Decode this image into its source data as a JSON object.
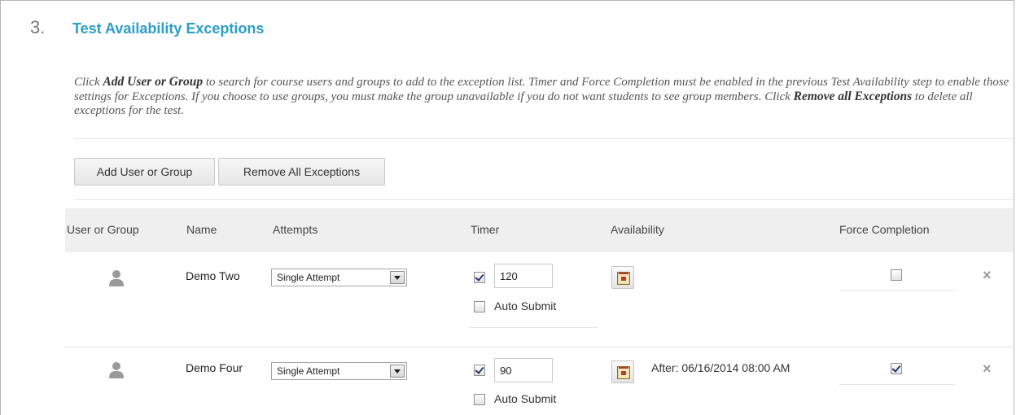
{
  "section": {
    "number": "3.",
    "title": "Test Availability Exceptions"
  },
  "instructions": {
    "t1": "Click ",
    "b1": "Add User or Group",
    "t2": " to search for course users and groups to add to the exception list. Timer and Force Completion must be enabled in the previous Test Availability step to enable those settings for Exceptions. If you choose to use groups, you must make the group unavailable if you do not want students to see group members. Click ",
    "b2": "Remove all Exceptions",
    "t3": " to delete all exceptions for the test."
  },
  "toolbar": {
    "add_label": "Add User or Group",
    "remove_all_label": "Remove All Exceptions"
  },
  "table": {
    "headers": {
      "user_or_group": "User or Group",
      "name": "Name",
      "attempts": "Attempts",
      "timer": "Timer",
      "availability": "Availability",
      "force_completion": "Force Completion"
    },
    "rows": [
      {
        "icon": "user-icon",
        "name": "Demo Two",
        "attempts": "Single Attempt",
        "timer_enabled": true,
        "timer_value": "120",
        "auto_submit_label": "Auto Submit",
        "auto_submit": false,
        "availability_text": "",
        "force_completion": false
      },
      {
        "icon": "user-icon",
        "name": "Demo Four",
        "attempts": "Single Attempt",
        "timer_enabled": true,
        "timer_value": "90",
        "auto_submit_label": "Auto Submit",
        "auto_submit": false,
        "availability_text": "After: 06/16/2014 08:00 AM",
        "force_completion": true
      }
    ]
  },
  "colors": {
    "title": "#2c9ec8",
    "header_bg": "#efefef",
    "check": "#233a78"
  },
  "icons": {
    "remove": "×",
    "calendar": "calendar-icon"
  }
}
